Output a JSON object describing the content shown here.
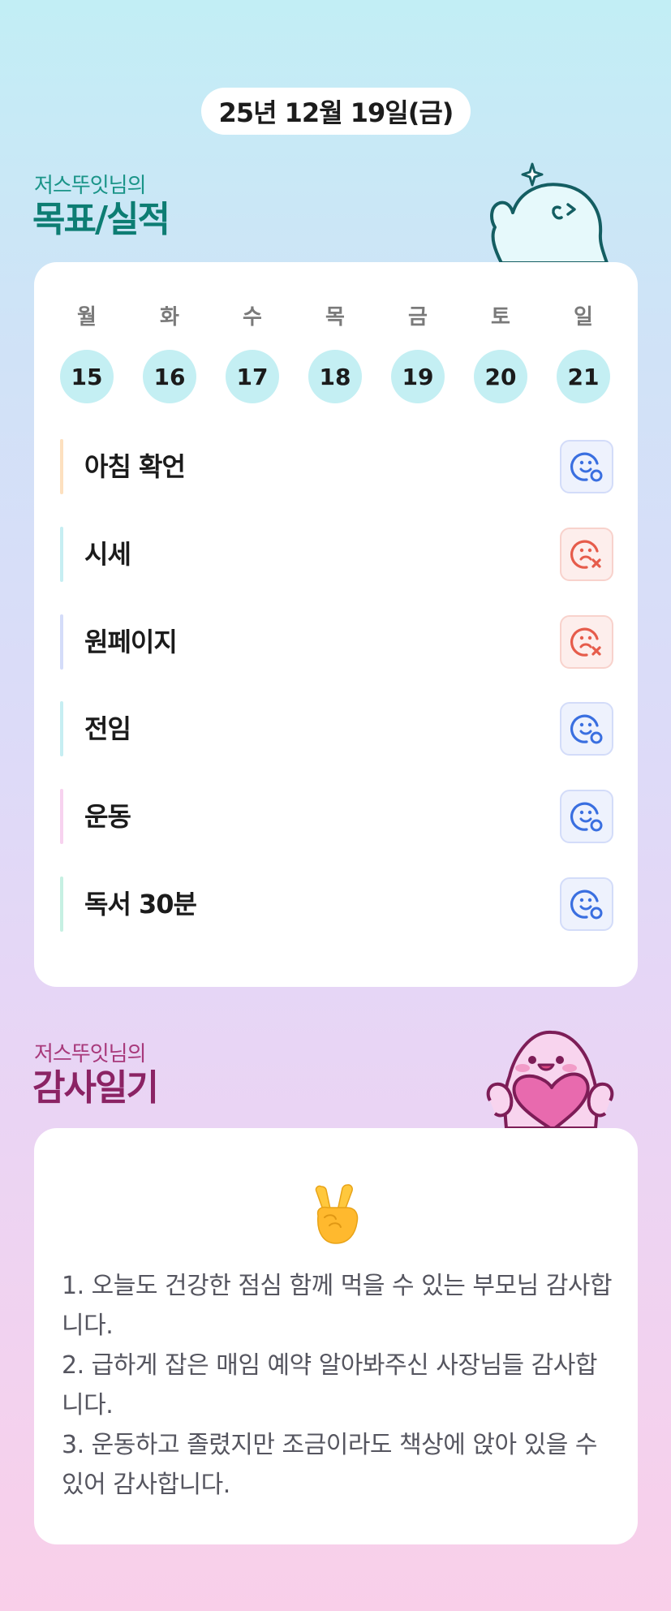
{
  "date": "25년 12월 19일(금)",
  "goals": {
    "subtitle": "저스뚜잇님의",
    "title": "목표/실적",
    "week": [
      {
        "day": "월",
        "date": "15"
      },
      {
        "day": "화",
        "date": "16"
      },
      {
        "day": "수",
        "date": "17"
      },
      {
        "day": "목",
        "date": "18"
      },
      {
        "day": "금",
        "date": "19"
      },
      {
        "day": "토",
        "date": "20"
      },
      {
        "day": "일",
        "date": "21"
      }
    ],
    "items": [
      {
        "label": "아침 확언",
        "status": "done",
        "bar_color": "#fde0bf"
      },
      {
        "label": "시세",
        "status": "missed",
        "bar_color": "#c6eef2"
      },
      {
        "label": "원페이지",
        "status": "missed",
        "bar_color": "#d4dcf9"
      },
      {
        "label": "전임",
        "status": "done",
        "bar_color": "#c6eef2"
      },
      {
        "label": "운동",
        "status": "done",
        "bar_color": "#f7d2ef"
      },
      {
        "label": "독서 30분",
        "status": "done",
        "bar_color": "#c6f0e2"
      }
    ],
    "status_colors": {
      "done": "#3a6fe0",
      "missed": "#e65c4b"
    }
  },
  "thanks": {
    "subtitle": "저스뚜잇님의",
    "title": "감사일기",
    "emoji": "peace-hand-icon",
    "text": "1. 오늘도 건강한 점심 함께 먹을 수 있는 부모님 감사합니다.\n2. 급하게 잡은 매임 예약 알아봐주신 사장님들 감사합니다.\n3. 운동하고 졸렸지만 조금이라도 책상에 앉아 있을 수 있어 감사합니다."
  }
}
